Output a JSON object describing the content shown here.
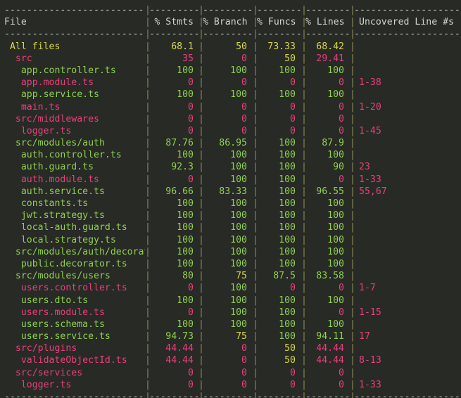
{
  "terminal": {
    "background": "#282a26",
    "colors": {
      "high": "#8fd14f",
      "medium": "#d7d74a",
      "low": "#e8407a",
      "header_text": "#d4d4cb",
      "separator": "#8a8a52",
      "dash": "#c9c9bf"
    },
    "separator_char": "|",
    "dash_char": "-"
  },
  "table": {
    "columns": [
      {
        "key": "file",
        "label": "File"
      },
      {
        "key": "stmts",
        "label": "% Stmts"
      },
      {
        "key": "branch",
        "label": "% Branch"
      },
      {
        "key": "funcs",
        "label": "% Funcs"
      },
      {
        "key": "lines",
        "label": "% Lines"
      },
      {
        "key": "uncovered",
        "label": "Uncovered Line #s"
      }
    ],
    "dashes": {
      "file": "---------------------------",
      "stmts": "---------",
      "branch": "----------",
      "funcs": "---------",
      "lines": "---------",
      "uncovered": "-------------------"
    },
    "rows": [
      {
        "file": "All files",
        "indent": 1,
        "name_color": "medium",
        "stmts": "68.1",
        "stmts_color": "medium",
        "branch": "50",
        "branch_color": "medium",
        "funcs": "73.33",
        "funcs_color": "medium",
        "lines": "68.42",
        "lines_color": "medium",
        "uncovered": ""
      },
      {
        "file": "src",
        "indent": 2,
        "name_color": "low",
        "stmts": "35",
        "stmts_color": "low",
        "branch": "0",
        "branch_color": "low",
        "funcs": "50",
        "funcs_color": "medium",
        "lines": "29.41",
        "lines_color": "low",
        "uncovered": ""
      },
      {
        "file": "app.controller.ts",
        "indent": 3,
        "name_color": "high",
        "stmts": "100",
        "stmts_color": "high",
        "branch": "100",
        "branch_color": "high",
        "funcs": "100",
        "funcs_color": "high",
        "lines": "100",
        "lines_color": "high",
        "uncovered": ""
      },
      {
        "file": "app.module.ts",
        "indent": 3,
        "name_color": "low",
        "stmts": "0",
        "stmts_color": "low",
        "branch": "0",
        "branch_color": "low",
        "funcs": "0",
        "funcs_color": "low",
        "lines": "0",
        "lines_color": "low",
        "uncovered": "1-38"
      },
      {
        "file": "app.service.ts",
        "indent": 3,
        "name_color": "high",
        "stmts": "100",
        "stmts_color": "high",
        "branch": "100",
        "branch_color": "high",
        "funcs": "100",
        "funcs_color": "high",
        "lines": "100",
        "lines_color": "high",
        "uncovered": ""
      },
      {
        "file": "main.ts",
        "indent": 3,
        "name_color": "low",
        "stmts": "0",
        "stmts_color": "low",
        "branch": "0",
        "branch_color": "low",
        "funcs": "0",
        "funcs_color": "low",
        "lines": "0",
        "lines_color": "low",
        "uncovered": "1-20"
      },
      {
        "file": "src/middlewares",
        "indent": 2,
        "name_color": "low",
        "stmts": "0",
        "stmts_color": "low",
        "branch": "0",
        "branch_color": "low",
        "funcs": "0",
        "funcs_color": "low",
        "lines": "0",
        "lines_color": "low",
        "uncovered": ""
      },
      {
        "file": "logger.ts",
        "indent": 3,
        "name_color": "low",
        "stmts": "0",
        "stmts_color": "low",
        "branch": "0",
        "branch_color": "low",
        "funcs": "0",
        "funcs_color": "low",
        "lines": "0",
        "lines_color": "low",
        "uncovered": "1-45"
      },
      {
        "file": "src/modules/auth",
        "indent": 2,
        "name_color": "high",
        "stmts": "87.76",
        "stmts_color": "high",
        "branch": "86.95",
        "branch_color": "high",
        "funcs": "100",
        "funcs_color": "high",
        "lines": "87.9",
        "lines_color": "high",
        "uncovered": ""
      },
      {
        "file": "auth.controller.ts",
        "indent": 3,
        "name_color": "high",
        "stmts": "100",
        "stmts_color": "high",
        "branch": "100",
        "branch_color": "high",
        "funcs": "100",
        "funcs_color": "high",
        "lines": "100",
        "lines_color": "high",
        "uncovered": ""
      },
      {
        "file": "auth.guard.ts",
        "indent": 3,
        "name_color": "high",
        "stmts": "92.3",
        "stmts_color": "high",
        "branch": "100",
        "branch_color": "high",
        "funcs": "100",
        "funcs_color": "high",
        "lines": "90",
        "lines_color": "high",
        "uncovered": "23"
      },
      {
        "file": "auth.module.ts",
        "indent": 3,
        "name_color": "low",
        "stmts": "0",
        "stmts_color": "low",
        "branch": "100",
        "branch_color": "high",
        "funcs": "100",
        "funcs_color": "high",
        "lines": "0",
        "lines_color": "low",
        "uncovered": "1-33"
      },
      {
        "file": "auth.service.ts",
        "indent": 3,
        "name_color": "high",
        "stmts": "96.66",
        "stmts_color": "high",
        "branch": "83.33",
        "branch_color": "high",
        "funcs": "100",
        "funcs_color": "high",
        "lines": "96.55",
        "lines_color": "high",
        "uncovered": "55,67"
      },
      {
        "file": "constants.ts",
        "indent": 3,
        "name_color": "high",
        "stmts": "100",
        "stmts_color": "high",
        "branch": "100",
        "branch_color": "high",
        "funcs": "100",
        "funcs_color": "high",
        "lines": "100",
        "lines_color": "high",
        "uncovered": ""
      },
      {
        "file": "jwt.strategy.ts",
        "indent": 3,
        "name_color": "high",
        "stmts": "100",
        "stmts_color": "high",
        "branch": "100",
        "branch_color": "high",
        "funcs": "100",
        "funcs_color": "high",
        "lines": "100",
        "lines_color": "high",
        "uncovered": ""
      },
      {
        "file": "local-auth.guard.ts",
        "indent": 3,
        "name_color": "high",
        "stmts": "100",
        "stmts_color": "high",
        "branch": "100",
        "branch_color": "high",
        "funcs": "100",
        "funcs_color": "high",
        "lines": "100",
        "lines_color": "high",
        "uncovered": ""
      },
      {
        "file": "local.strategy.ts",
        "indent": 3,
        "name_color": "high",
        "stmts": "100",
        "stmts_color": "high",
        "branch": "100",
        "branch_color": "high",
        "funcs": "100",
        "funcs_color": "high",
        "lines": "100",
        "lines_color": "high",
        "uncovered": ""
      },
      {
        "file": "src/modules/auth/decorators",
        "indent": 2,
        "name_color": "high",
        "stmts": "100",
        "stmts_color": "high",
        "branch": "100",
        "branch_color": "high",
        "funcs": "100",
        "funcs_color": "high",
        "lines": "100",
        "lines_color": "high",
        "uncovered": ""
      },
      {
        "file": "public.decorator.ts",
        "indent": 3,
        "name_color": "high",
        "stmts": "100",
        "stmts_color": "high",
        "branch": "100",
        "branch_color": "high",
        "funcs": "100",
        "funcs_color": "high",
        "lines": "100",
        "lines_color": "high",
        "uncovered": ""
      },
      {
        "file": "src/modules/users",
        "indent": 2,
        "name_color": "high",
        "stmts": "80",
        "stmts_color": "high",
        "branch": "75",
        "branch_color": "medium",
        "funcs": "87.5",
        "funcs_color": "high",
        "lines": "83.58",
        "lines_color": "high",
        "uncovered": ""
      },
      {
        "file": "users.controller.ts",
        "indent": 3,
        "name_color": "low",
        "stmts": "0",
        "stmts_color": "low",
        "branch": "100",
        "branch_color": "high",
        "funcs": "0",
        "funcs_color": "low",
        "lines": "0",
        "lines_color": "low",
        "uncovered": "1-7"
      },
      {
        "file": "users.dto.ts",
        "indent": 3,
        "name_color": "high",
        "stmts": "100",
        "stmts_color": "high",
        "branch": "100",
        "branch_color": "high",
        "funcs": "100",
        "funcs_color": "high",
        "lines": "100",
        "lines_color": "high",
        "uncovered": ""
      },
      {
        "file": "users.module.ts",
        "indent": 3,
        "name_color": "low",
        "stmts": "0",
        "stmts_color": "low",
        "branch": "100",
        "branch_color": "high",
        "funcs": "100",
        "funcs_color": "high",
        "lines": "0",
        "lines_color": "low",
        "uncovered": "1-15"
      },
      {
        "file": "users.schema.ts",
        "indent": 3,
        "name_color": "high",
        "stmts": "100",
        "stmts_color": "high",
        "branch": "100",
        "branch_color": "high",
        "funcs": "100",
        "funcs_color": "high",
        "lines": "100",
        "lines_color": "high",
        "uncovered": ""
      },
      {
        "file": "users.service.ts",
        "indent": 3,
        "name_color": "high",
        "stmts": "94.73",
        "stmts_color": "high",
        "branch": "75",
        "branch_color": "medium",
        "funcs": "100",
        "funcs_color": "high",
        "lines": "94.11",
        "lines_color": "high",
        "uncovered": "17"
      },
      {
        "file": "src/plugins",
        "indent": 2,
        "name_color": "low",
        "stmts": "44.44",
        "stmts_color": "low",
        "branch": "0",
        "branch_color": "low",
        "funcs": "50",
        "funcs_color": "medium",
        "lines": "44.44",
        "lines_color": "low",
        "uncovered": ""
      },
      {
        "file": "validateObjectId.ts",
        "indent": 3,
        "name_color": "low",
        "stmts": "44.44",
        "stmts_color": "low",
        "branch": "0",
        "branch_color": "low",
        "funcs": "50",
        "funcs_color": "medium",
        "lines": "44.44",
        "lines_color": "low",
        "uncovered": "8-13"
      },
      {
        "file": "src/services",
        "indent": 2,
        "name_color": "low",
        "stmts": "0",
        "stmts_color": "low",
        "branch": "0",
        "branch_color": "low",
        "funcs": "0",
        "funcs_color": "low",
        "lines": "0",
        "lines_color": "low",
        "uncovered": ""
      },
      {
        "file": "logger.ts",
        "indent": 3,
        "name_color": "low",
        "stmts": "0",
        "stmts_color": "low",
        "branch": "0",
        "branch_color": "low",
        "funcs": "0",
        "funcs_color": "low",
        "lines": "0",
        "lines_color": "low",
        "uncovered": "1-33"
      }
    ]
  }
}
